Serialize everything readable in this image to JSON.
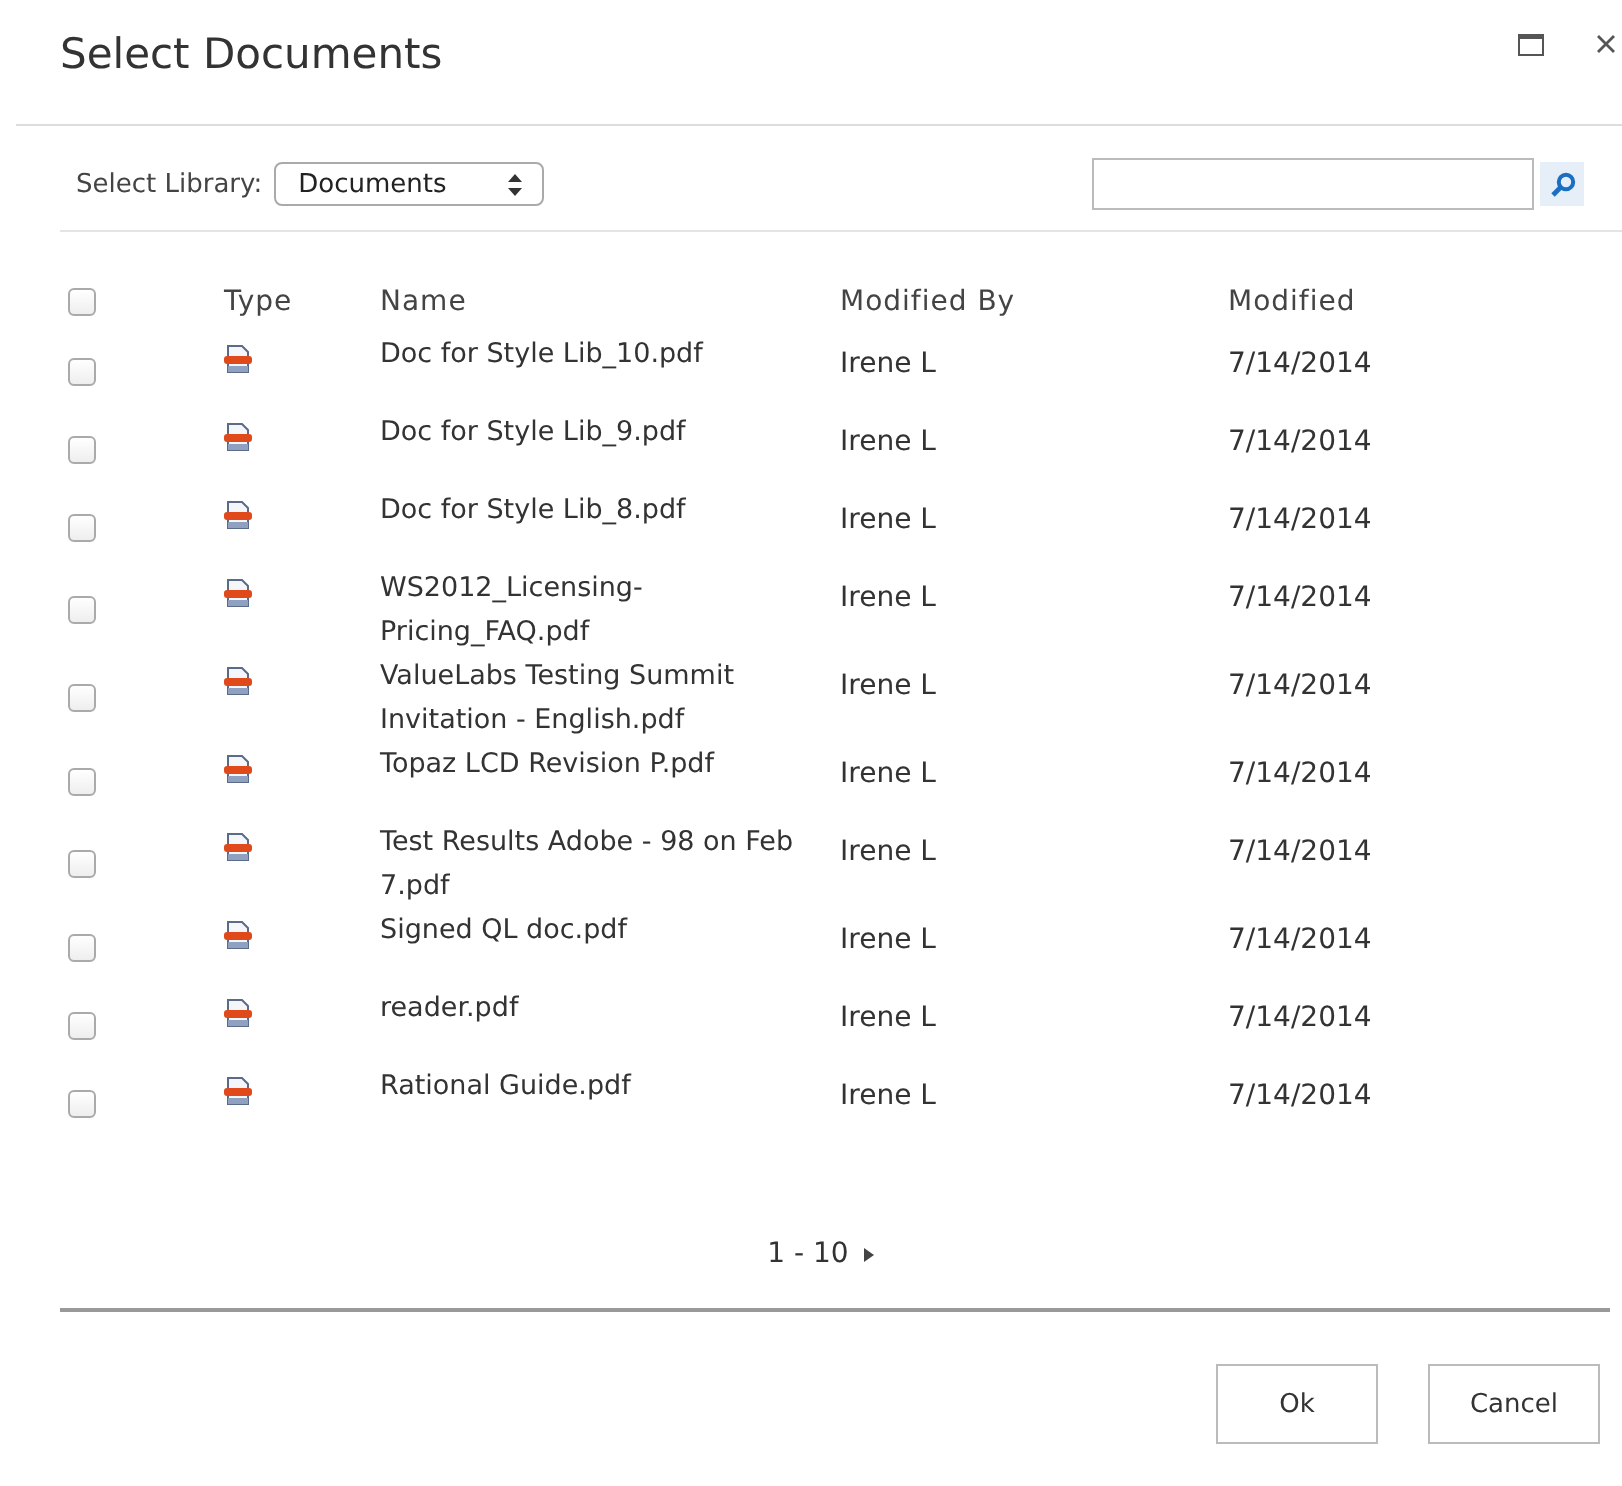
{
  "window": {
    "title": "Select Documents"
  },
  "library": {
    "label": "Select Library:",
    "value": "Documents"
  },
  "table": {
    "select_all": {
      "checked": false
    },
    "columns": [
      "Type",
      "Name",
      "Modified By",
      "Modified"
    ],
    "rows": [
      {
        "checked": false,
        "name": "Doc for Style Lib_10.pdf",
        "modified_by": "Irene L",
        "modified": "7/14/2014"
      },
      {
        "checked": false,
        "name": "Doc for Style Lib_9.pdf",
        "modified_by": "Irene L",
        "modified": "7/14/2014"
      },
      {
        "checked": false,
        "name": "Doc for Style Lib_8.pdf",
        "modified_by": "Irene L",
        "modified": "7/14/2014"
      },
      {
        "checked": false,
        "name": "WS2012_Licensing-Pricing_FAQ.pdf",
        "modified_by": "Irene L",
        "modified": "7/14/2014"
      },
      {
        "checked": false,
        "name": "ValueLabs Testing Summit Invitation - English.pdf",
        "modified_by": "Irene L",
        "modified": "7/14/2014"
      },
      {
        "checked": false,
        "name": "Topaz LCD Revision P.pdf",
        "modified_by": "Irene L",
        "modified": "7/14/2014"
      },
      {
        "checked": false,
        "name": "Test Results Adobe - 98 on Feb 7.pdf",
        "modified_by": "Irene L",
        "modified": "7/14/2014"
      },
      {
        "checked": false,
        "name": "Signed QL doc.pdf",
        "modified_by": "Irene L",
        "modified": "7/14/2014"
      },
      {
        "checked": false,
        "name": "reader.pdf",
        "modified_by": "Irene L",
        "modified": "7/14/2014"
      },
      {
        "checked": false,
        "name": "Rational Guide.pdf",
        "modified_by": "Irene L",
        "modified": "7/14/2014"
      }
    ]
  },
  "pagination": {
    "range": "1 - 10"
  },
  "buttons": [
    "Ok",
    "Cancel"
  ]
}
